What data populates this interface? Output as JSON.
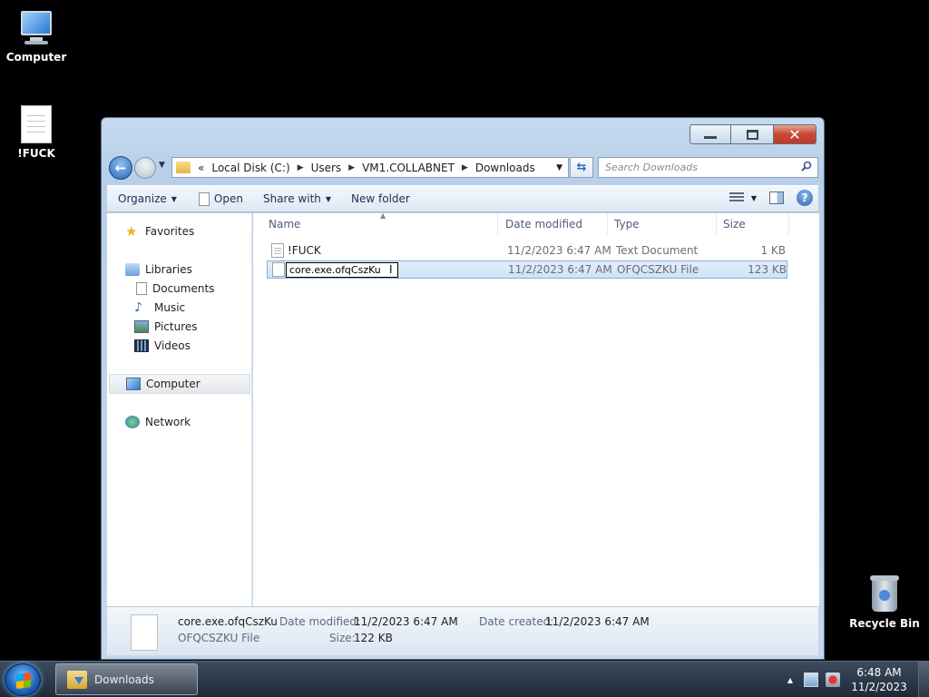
{
  "desktop": {
    "icons": [
      {
        "label": "Computer"
      },
      {
        "label": "!FUCK"
      },
      {
        "label": "Recycle Bin"
      }
    ]
  },
  "window": {
    "caption": {
      "minimize": "minimize",
      "maximize": "maximize",
      "close": "✕"
    },
    "address": {
      "overflow": "«",
      "segments": [
        "Local Disk (C:)",
        "Users",
        "VM1.COLLABNET",
        "Downloads"
      ]
    },
    "search": {
      "placeholder": "Search Downloads"
    },
    "toolbar": {
      "organize": "Organize",
      "open": "Open",
      "share_with": "Share with",
      "new_folder": "New folder"
    },
    "nav": {
      "favorites": "Favorites",
      "libraries": "Libraries",
      "documents": "Documents",
      "music": "Music",
      "pictures": "Pictures",
      "videos": "Videos",
      "computer": "Computer",
      "network": "Network"
    },
    "columns": {
      "name": "Name",
      "date_modified": "Date modified",
      "type": "Type",
      "size": "Size"
    },
    "files": [
      {
        "name": "!FUCK",
        "date": "11/2/2023 6:47 AM",
        "type": "Text Document",
        "size": "1 KB"
      },
      {
        "name": "core.exe.ofqCszKu",
        "date": "11/2/2023 6:47 AM",
        "type": "OFQCSZKU File",
        "size": "123 KB"
      }
    ],
    "details": {
      "name": "core.exe.ofqCszKu",
      "type": "OFQCSZKU File",
      "date_modified_label": "Date modified:",
      "date_modified": "11/2/2023 6:47 AM",
      "date_created_label": "Date created:",
      "date_created": "11/2/2023 6:47 AM",
      "size_label": "Size:",
      "size": "122 KB"
    }
  },
  "taskbar": {
    "task_label": "Downloads",
    "time": "6:48 AM",
    "date": "11/2/2023"
  }
}
